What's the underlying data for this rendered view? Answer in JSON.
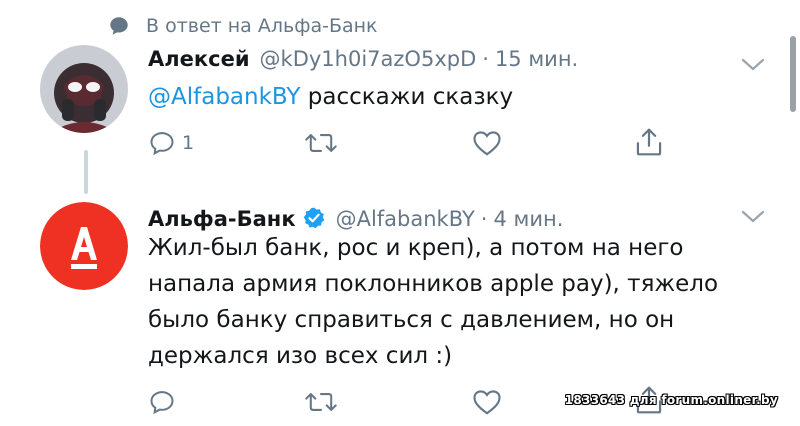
{
  "reply_context": {
    "icon": "speech-bubble-icon",
    "text": "В ответ на Альфа-Банк"
  },
  "tweets": [
    {
      "author_name": "Алексей",
      "handle": "@kDy1h0i7azO5xpD",
      "separator": "·",
      "time": "15 мин.",
      "mention": "@AlfabankBY",
      "text": " расскажи сказку",
      "reply_count": "1",
      "avatar": "deadpool-avatar-icon"
    },
    {
      "author_name": "Альфа-Банк",
      "verified": true,
      "handle": "@AlfabankBY",
      "separator": "·",
      "time": "4 мин.",
      "text_lines": [
        "Жил-был банк, рос и креп), а потом на него",
        "напала армия поклонников apple pay), тяжело",
        "было банку справиться с давлением, но он",
        "держался изо всех сил :)"
      ],
      "reply_count": "",
      "avatar": "alfa-bank-logo-icon",
      "brand_color": "#ef3124"
    }
  ],
  "watermark": "1833643 для forum.onliner.by",
  "colors": {
    "accent": "#1b95e0",
    "muted": "#657786",
    "verified": "#1da1f2"
  }
}
